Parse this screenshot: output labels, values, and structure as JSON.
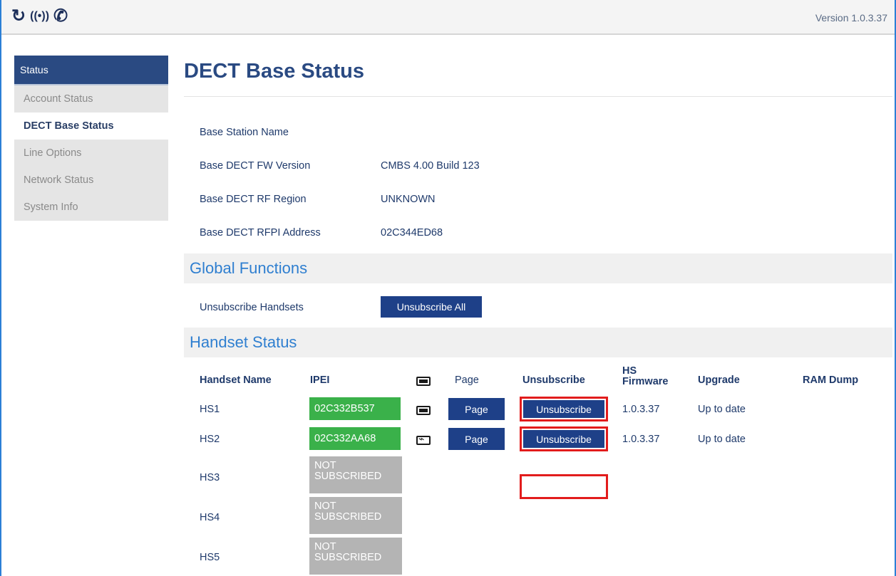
{
  "topbar": {
    "icons": [
      "refresh-icon",
      "signal-icon",
      "phone-icon"
    ],
    "version": "Version 1.0.3.37"
  },
  "sidebar": {
    "header": "Status",
    "items": [
      {
        "label": "Account Status",
        "active": false
      },
      {
        "label": "DECT Base Status",
        "active": true
      },
      {
        "label": "Line Options",
        "active": false
      },
      {
        "label": "Network Status",
        "active": false
      },
      {
        "label": "System Info",
        "active": false
      }
    ]
  },
  "main": {
    "title": "DECT Base Status",
    "info": [
      {
        "label": "Base Station Name",
        "value": ""
      },
      {
        "label": "Base DECT FW Version",
        "value": "CMBS 4.00 Build 123"
      },
      {
        "label": "Base DECT RF Region",
        "value": "UNKNOWN"
      },
      {
        "label": "Base DECT RFPI Address",
        "value": "02C344ED68"
      }
    ],
    "global_functions": {
      "title": "Global Functions",
      "label": "Unsubscribe Handsets",
      "button": "Unsubscribe All"
    },
    "handset_status": {
      "title": "Handset Status",
      "headers": {
        "name": "Handset Name",
        "ipei": "IPEI",
        "page": "Page",
        "unsubscribe": "Unsubscribe",
        "firmware": "HS Firmware",
        "upgrade": "Upgrade",
        "ramdump": "RAM Dump"
      },
      "rows": [
        {
          "name": "HS1",
          "ipei": "02C332B537",
          "battery": "full",
          "page": "Page",
          "unsubscribe": "Unsubscribe",
          "firmware": "1.0.3.37",
          "upgrade": "Up to date"
        },
        {
          "name": "HS2",
          "ipei": "02C332AA68",
          "battery": "charging",
          "page": "Page",
          "unsubscribe": "Unsubscribe",
          "firmware": "1.0.3.37",
          "upgrade": "Up to date"
        },
        {
          "name": "HS3",
          "ipei_line1": "NOT",
          "ipei_line2": "SUBSCRIBED"
        },
        {
          "name": "HS4",
          "ipei_line1": "NOT",
          "ipei_line2": "SUBSCRIBED"
        },
        {
          "name": "HS5",
          "ipei_line1": "NOT",
          "ipei_line2": "SUBSCRIBED"
        }
      ]
    }
  },
  "colors": {
    "accent": "#2a4a82",
    "button": "#1e4088",
    "section_title": "#2f7fd0",
    "subscribed": "#3ab14a",
    "not_subscribed": "#b4b4b4",
    "highlight": "#e21c1c"
  }
}
